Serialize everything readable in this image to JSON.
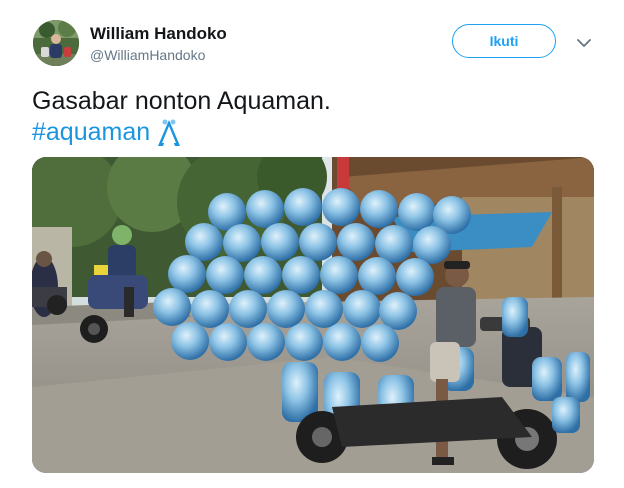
{
  "author": {
    "name": "William Handoko",
    "handle": "@WilliamHandoko"
  },
  "follow_button": {
    "label": "Ikuti"
  },
  "tweet": {
    "text": "Gasabar nonton Aquaman.",
    "hashtag": "#aquaman"
  },
  "icons": {
    "avatar": "profile-photo",
    "menu": "chevron-down-icon",
    "hashtag_emoji": "aquaman-trident-icon"
  },
  "colors": {
    "accent": "#1da1f2",
    "hashtag": "#1b95e0",
    "text": "#14171a",
    "secondary_text": "#657786"
  }
}
